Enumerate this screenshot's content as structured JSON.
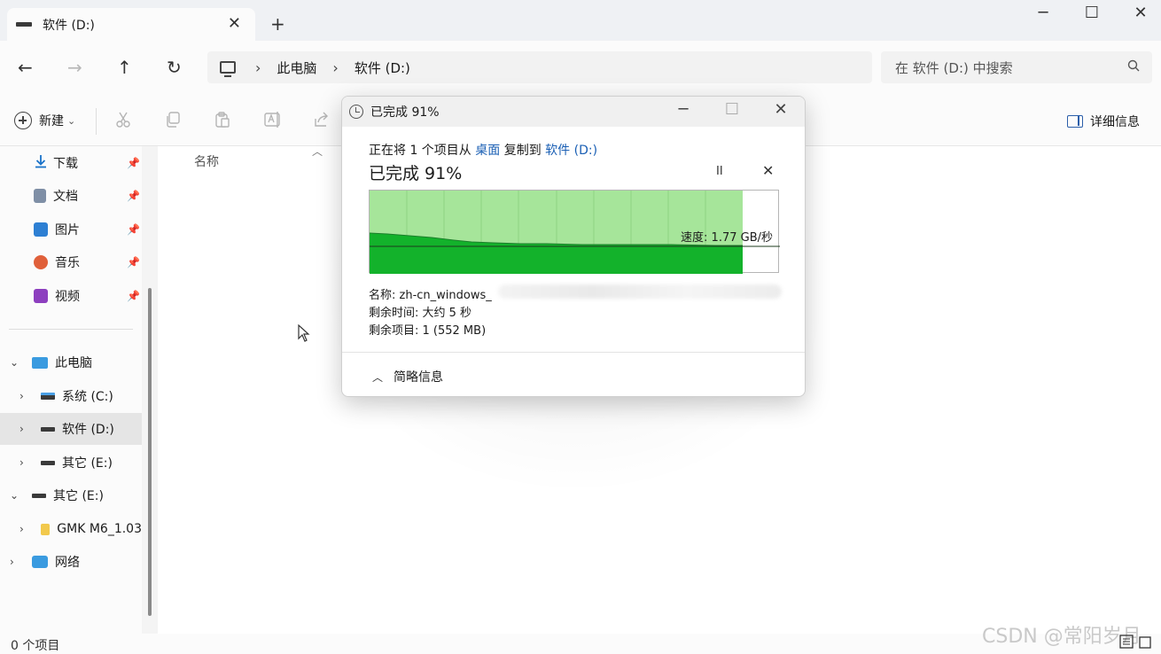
{
  "window": {
    "tab_label": "软件 (D:)",
    "tab_close": "✕",
    "new_tab": "+",
    "minimize": "─",
    "maximize": "☐",
    "close": "✕"
  },
  "nav": {
    "back": "←",
    "forward": "→",
    "up": "↑",
    "refresh": "↻"
  },
  "address": {
    "crumb_separator": "›",
    "crumbs": [
      "此电脑",
      "软件 (D:)"
    ]
  },
  "search": {
    "placeholder": "在 软件 (D:) 中搜索",
    "icon": "search-icon"
  },
  "toolbar": {
    "new_label": "新建",
    "new_caret": "⌄",
    "details_label": "详细信息",
    "icons": [
      "cut-icon",
      "copy-icon",
      "paste-icon",
      "rename-icon",
      "share-icon"
    ]
  },
  "sidebar": {
    "quick_access": [
      {
        "label": "下载",
        "icon": "download-icon",
        "pinned": true
      },
      {
        "label": "文档",
        "icon": "document-icon",
        "pinned": true
      },
      {
        "label": "图片",
        "icon": "pictures-icon",
        "pinned": true
      },
      {
        "label": "音乐",
        "icon": "music-icon",
        "pinned": true
      },
      {
        "label": "视频",
        "icon": "videos-icon",
        "pinned": true
      }
    ],
    "tree": [
      {
        "label": "此电脑",
        "icon": "this-pc-icon",
        "expanded": true
      },
      {
        "label": "系统 (C:)",
        "icon": "drive-c-icon",
        "expanded": false
      },
      {
        "label": "软件 (D:)",
        "icon": "drive-icon",
        "expanded": false,
        "selected": true
      },
      {
        "label": "其它 (E:)",
        "icon": "drive-icon",
        "expanded": false
      },
      {
        "label": "其它 (E:)",
        "icon": "drive-icon",
        "expanded": true
      },
      {
        "label": "GMK M6_1.03",
        "icon": "folder-icon",
        "expanded": false
      },
      {
        "label": "网络",
        "icon": "network-icon",
        "expanded": false
      }
    ],
    "pin_glyph": "📌",
    "chevron_right": "›",
    "chevron_down": "⌄"
  },
  "content": {
    "column_name": "名称",
    "sort_glyph": "︿"
  },
  "status": {
    "item_count": "0 个项目"
  },
  "watermark": "CSDN @常阳岁月",
  "dialog": {
    "title": "已完成 91%",
    "progress_percent": 91,
    "from_prefix": "正在将 1 个项目从 ",
    "from_source": "桌面",
    "from_middle": " 复制到 ",
    "from_dest": "软件 (D:)",
    "status_heading": "已完成 91%",
    "pause_glyph": "II",
    "cancel_glyph": "✕",
    "speed": "速度: 1.77 GB/秒",
    "name_label": "名称: zh-cn_windows_",
    "time_remaining": "剩余时间: 大约 5 秒",
    "items_remaining": "剩余项目: 1 (552 MB)",
    "fewer_details": "简略信息",
    "fewer_glyph": "︿",
    "colors": {
      "fill_light": "#a6e59a",
      "fill_dark": "#13b22b",
      "link": "#1a5fb4"
    }
  }
}
